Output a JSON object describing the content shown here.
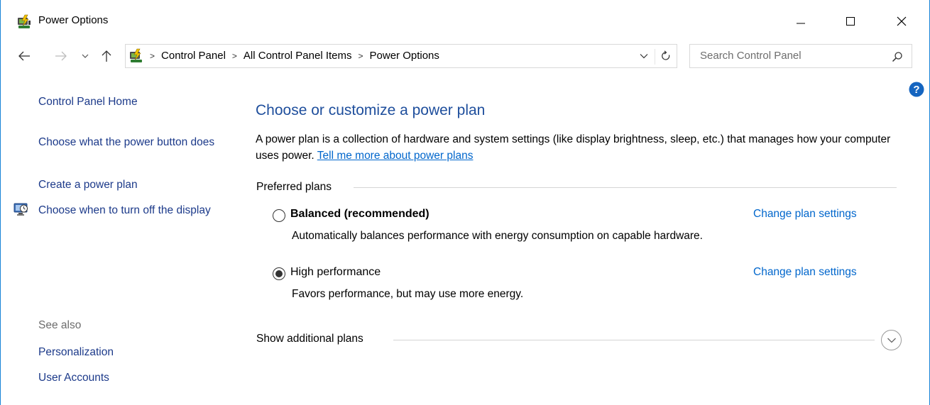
{
  "window": {
    "title": "Power Options"
  },
  "address_bar": {
    "crumbs": [
      "Control Panel",
      "All Control Panel Items",
      "Power Options"
    ]
  },
  "search": {
    "placeholder": "Search Control Panel"
  },
  "sidebar": {
    "home": "Control Panel Home",
    "links": [
      "Choose what the power button does",
      "Create a power plan",
      "Choose when to turn off the display"
    ],
    "see_also_label": "See also",
    "see_also": [
      "Personalization",
      "User Accounts"
    ]
  },
  "main": {
    "heading": "Choose or customize a power plan",
    "description": "A power plan is a collection of hardware and system settings (like display brightness, sleep, etc.) that manages how your computer uses power.",
    "description_link": "Tell me more about power plans",
    "preferred_label": "Preferred plans",
    "plans": [
      {
        "name": "Balanced (recommended)",
        "description": "Automatically balances performance with energy consumption on capable hardware.",
        "change_label": "Change plan settings",
        "selected": false
      },
      {
        "name": "High performance",
        "description": "Favors performance, but may use more energy.",
        "change_label": "Change plan settings",
        "selected": true
      }
    ],
    "additional_label": "Show additional plans"
  },
  "colors": {
    "link": "#0066cc",
    "sidebar_link": "#1c3a8a",
    "heading": "#1e4e9c",
    "window_border": "#1883d7"
  },
  "icons": {
    "app": "power-options-icon",
    "help": "help-icon",
    "display": "display-power-icon"
  }
}
